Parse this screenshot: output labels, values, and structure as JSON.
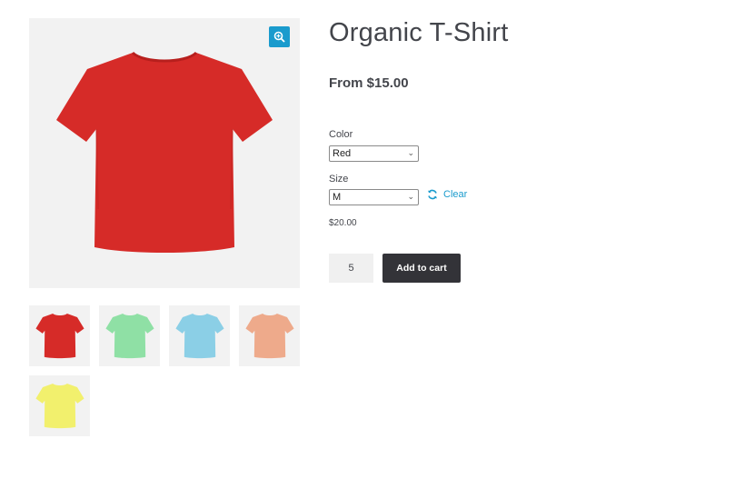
{
  "product": {
    "title": "Organic T-Shirt",
    "price_range": "From $15.00",
    "variation_price": "$20.00"
  },
  "gallery": {
    "main_color": "#d62b28",
    "zoom_icon": "zoom-in-icon",
    "thumbnails": [
      {
        "color": "#d62b28"
      },
      {
        "color": "#8fe0a5"
      },
      {
        "color": "#8bcfe6"
      },
      {
        "color": "#eeaa8b"
      },
      {
        "color": "#f2f06d"
      }
    ]
  },
  "variations": {
    "color_label": "Color",
    "color_value": "Red",
    "size_label": "Size",
    "size_value": "M",
    "clear_label": "Clear",
    "clear_icon": "refresh-icon"
  },
  "cart": {
    "quantity": "5",
    "add_label": "Add to cart"
  },
  "colors": {
    "accent": "#1a9bcd",
    "button": "#333338",
    "text": "#43454b"
  }
}
